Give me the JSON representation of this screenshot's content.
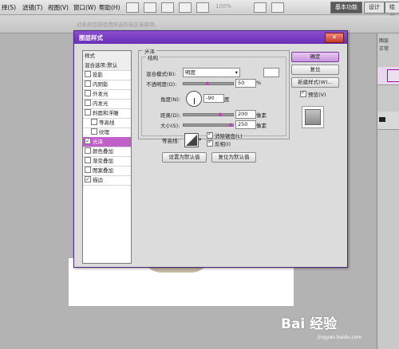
{
  "menubar": {
    "items": [
      "择(S)",
      "滤镜(T)",
      "视图(V)",
      "窗口(W)",
      "帮助(H)"
    ],
    "zoom": "100%",
    "workspace_essentials": "基本功能",
    "workspace_design": "设计",
    "workspace_paint": "绘画"
  },
  "options": {
    "hint": "对系统目前使用所选的选区选择项。"
  },
  "dialog": {
    "title": "图层样式",
    "close_label": "✕",
    "styles_header": "样式",
    "blend_options": "混合选项:默认",
    "effects": [
      {
        "label": "投影",
        "checked": false,
        "selected": false
      },
      {
        "label": "内阴影",
        "checked": false,
        "selected": false
      },
      {
        "label": "外发光",
        "checked": false,
        "selected": false
      },
      {
        "label": "内发光",
        "checked": false,
        "selected": false
      },
      {
        "label": "斜面和浮雕",
        "checked": false,
        "selected": false
      },
      {
        "label": "等高线",
        "checked": false,
        "selected": false,
        "indent": true
      },
      {
        "label": "纹理",
        "checked": false,
        "selected": false,
        "indent": true
      },
      {
        "label": "光泽",
        "checked": true,
        "selected": true
      },
      {
        "label": "颜色叠加",
        "checked": false,
        "selected": false
      },
      {
        "label": "渐变叠加",
        "checked": false,
        "selected": false
      },
      {
        "label": "图案叠加",
        "checked": false,
        "selected": false
      },
      {
        "label": "描边",
        "checked": true,
        "selected": false
      }
    ],
    "satin": {
      "group_title": "光泽",
      "struct_title": "结构",
      "blend_mode_label": "混合模式(B):",
      "blend_mode_value": "明度",
      "opacity_label": "不透明度(O):",
      "opacity_value": "50",
      "opacity_unit": "%",
      "angle_label": "角度(N):",
      "angle_value": "-90",
      "angle_unit": "度",
      "distance_label": "距离(D):",
      "distance_value": "200",
      "distance_unit": "像素",
      "size_label": "大小(S):",
      "size_value": "250",
      "size_unit": "像素",
      "contour_label": "等高线:",
      "anti_alias_label": "消除锯齿(L)",
      "anti_alias_checked": true,
      "invert_label": "反相(I)",
      "invert_checked": true,
      "make_default": "设置为默认值",
      "reset_default": "复位为默认值"
    },
    "buttons": {
      "ok": "确定",
      "reset": "复位",
      "new_style": "新建样式(W)...",
      "preview_label": "预览(V)",
      "preview_checked": true
    }
  },
  "right_panel": {
    "tab1": "图层",
    "tab2": "通道",
    "mode": "正常"
  },
  "watermark": {
    "brand": "Bai 经验",
    "url": "jingyan.baidu.com"
  }
}
